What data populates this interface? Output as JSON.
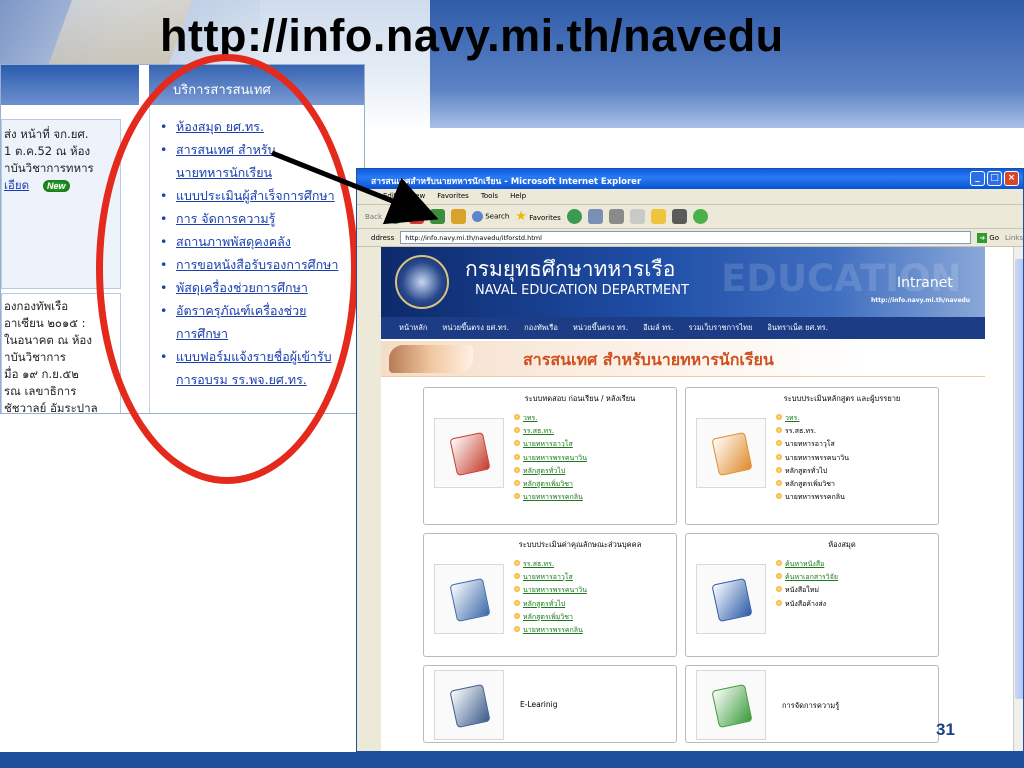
{
  "slide": {
    "title": "http://info.navy.mi.th/navedu",
    "page_number": "31"
  },
  "left_panel": {
    "services_header": "บริการสารสนเทศ",
    "news_lines": [
      "ส่ง หน้าที่ จก.ยศ.",
      "1 ต.ค.52 ณ ห้อง",
      "าบันวิชาการทหาร"
    ],
    "news_more": "เอียด",
    "new_badge": "New",
    "news2_lines": [
      "องกองทัพเรือ",
      "อาเซียน ๒๐๑๕ :",
      "ในอนาคต ณ ห้อง",
      "าบันวิชาการ",
      "มื่อ ๑๙ ก.ย.๕๒",
      "รณ เลขาธิการ",
      "ชัชวาลย์ อัมระปาล"
    ],
    "services": [
      "ห้องสมุด ยศ.ทร.",
      "สารสนเทศ สำหรับ",
      "นายทหารนักเรียน",
      "แบบประเมินผู้สำเร็จการศึกษา",
      "การ จัดการความรู้",
      "สถานภาพพัสดุคงคลัง",
      "การขอหนังสือรับรองการศึกษา",
      "พัสดุเครื่องช่วยการศึกษา",
      "อัตราครุภัณฑ์เครื่องช่วย",
      "การศึกษา",
      "แบบฟอร์มแจ้งรายชื่อผู้เข้ารับ",
      "การอบรม รร.พจ.ยศ.ทร."
    ]
  },
  "browser": {
    "window_title": "สารสนเทศสำหรับนายทหารนักเรียน - Microsoft Internet Explorer",
    "menu": [
      "Edit",
      "View",
      "Favorites",
      "Tools",
      "Help"
    ],
    "back_label": "Back",
    "search_label": "Search",
    "favorites_label": "Favorites",
    "address_label": "ddress",
    "address_url": "http://info.navy.mi.th/navedu/itforstd.html",
    "go_label": "Go",
    "links_label": "Links",
    "win_minimize": "_",
    "win_maximize": "□",
    "win_close": "×"
  },
  "site": {
    "title_th": "กรมยุทธศึกษาทหารเรือ",
    "title_en": "NAVAL EDUCATION DEPARTMENT",
    "watermark": "EDUCATION",
    "intranet": "Intranet",
    "url": "http://info.navy.mi.th/navedu",
    "nav": [
      "หน้าหลัก",
      "หน่วยขึ้นตรง ยศ.ทร.",
      "กองทัพเรือ",
      "หน่วยขึ้นตรง ทร.",
      "อีเมล์ ทร.",
      "รวมเว็บราชการไทย",
      "อินทราเน็ต ยศ.ทร."
    ],
    "banner": "สารสนเทศ  สำหรับนายทหารนักเรียน",
    "cards": [
      {
        "title": "ระบบทดสอบ ก่อนเรียน / หลังเรียน",
        "icon": "clipboard-check-icon",
        "items": [
          {
            "text": "วทร.",
            "link": true
          },
          {
            "text": "รร.สธ.ทร.",
            "link": true
          },
          {
            "text": "นายทหารอาวุโส",
            "link": true
          },
          {
            "text": "นายทหารพรรคนาวิน",
            "link": true
          },
          {
            "text": "หลักสูตรทั่วไป",
            "link": true
          },
          {
            "text": "หลักสูตรเพิ่มวิชา",
            "link": true
          },
          {
            "text": "นายทหารพรรคกลิน",
            "link": true
          }
        ]
      },
      {
        "title": "ระบบประเมินหลักสูตร และผู้บรรยาย",
        "icon": "form-edit-icon",
        "items": [
          {
            "text": "วทร.",
            "link": true
          },
          {
            "text": "รร.สธ.ทร.",
            "link": false
          },
          {
            "text": "นายทหารอาวุโส",
            "link": false
          },
          {
            "text": "นายทหารพรรคนาวิน",
            "link": false
          },
          {
            "text": "หลักสูตรทั่วไป",
            "link": false
          },
          {
            "text": "หลักสูตรเพิ่มวิชา",
            "link": false
          },
          {
            "text": "นายทหารพรรคกลิน",
            "link": false
          }
        ]
      },
      {
        "title": "ระบบประเมินค่าคุณลักษณะส่วนบุคคล",
        "icon": "pen-checklist-icon",
        "items": [
          {
            "text": "รร.สธ.ทร.",
            "link": true
          },
          {
            "text": "นายทหารอาวุโส",
            "link": true
          },
          {
            "text": "นายทหารพรรคนาวิน",
            "link": true
          },
          {
            "text": "หลักสูตรทั่วไป",
            "link": true
          },
          {
            "text": "หลักสูตรเพิ่มวิชา",
            "link": true
          },
          {
            "text": "นายทหารพรรคกลิน",
            "link": true
          }
        ]
      },
      {
        "title": "ห้องสมุด",
        "icon": "book-icon",
        "items": [
          {
            "text": "ค้นหาหนังสือ",
            "link": true
          },
          {
            "text": "ค้นหาเอกสารวิจัย",
            "link": true
          },
          {
            "text": "หนังสือใหม่",
            "link": false
          },
          {
            "text": "หนังสือค้างส่ง",
            "link": false
          }
        ]
      },
      {
        "title": "E-Learinig",
        "icon": "laptop-icon",
        "items": []
      },
      {
        "title": "การจัดการความรู้",
        "icon": "document-cycle-icon",
        "items": []
      }
    ]
  },
  "colors": {
    "accent_red": "#e42a1d",
    "footer_blue": "#1c4f9c",
    "link_green": "#1b7a1b",
    "banner_orange": "#cf4f1d"
  }
}
